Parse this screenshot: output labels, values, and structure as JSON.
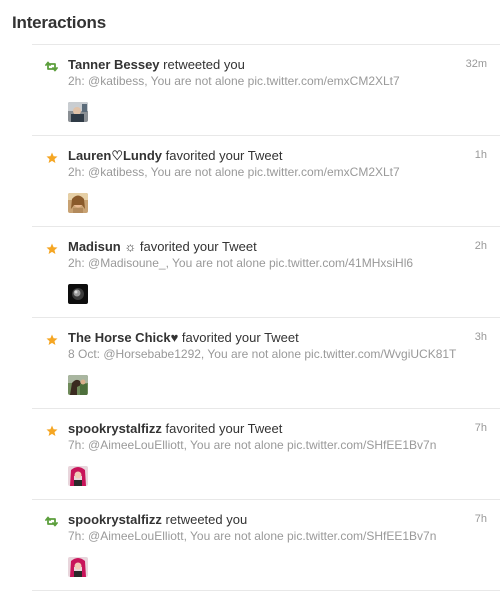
{
  "page": {
    "title": "Interactions"
  },
  "colors": {
    "retweet_green": "#5c9f3d",
    "favorite_orange": "#f5a623",
    "text_dark": "#333333",
    "text_muted": "#999999",
    "divider": "#e8e8e8"
  },
  "interactions": [
    {
      "icon": "retweet-icon",
      "user": "Tanner Bessey",
      "action": " retweeted you",
      "time": "32m",
      "detail": "2h: @katibess, You are not alone pic.twitter.com/emxCM2XLt7",
      "avatar": "avatar-tanner"
    },
    {
      "icon": "star-icon",
      "user": "Lauren♡Lundy",
      "action": " favorited your Tweet",
      "time": "1h",
      "detail": "2h: @katibess, You are not alone pic.twitter.com/emxCM2XLt7",
      "avatar": "avatar-lauren"
    },
    {
      "icon": "star-icon",
      "user": "Madisun ☼",
      "action": " favorited your Tweet",
      "time": "2h",
      "detail": "2h: @Madisoune_, You are not alone pic.twitter.com/41MHxsiHl6",
      "avatar": "avatar-madisun"
    },
    {
      "icon": "star-icon",
      "user": "The Horse Chick♥",
      "action": " favorited your Tweet",
      "time": "3h",
      "detail": "8 Oct: @Horsebabe1292, You are not alone pic.twitter.com/WvgiUCK81T",
      "avatar": "avatar-horse-chick"
    },
    {
      "icon": "star-icon",
      "user": "spookrystalfizz",
      "action": " favorited your Tweet",
      "time": "7h",
      "detail": "7h: @AimeeLouElliott, You are not alone pic.twitter.com/SHfEE1Bv7n",
      "avatar": "avatar-spookrystalfizz"
    },
    {
      "icon": "retweet-icon",
      "user": "spookrystalfizz",
      "action": " retweeted you",
      "time": "7h",
      "detail": "7h: @AimeeLouElliott, You are not alone pic.twitter.com/SHfEE1Bv7n",
      "avatar": "avatar-spookrystalfizz"
    }
  ]
}
